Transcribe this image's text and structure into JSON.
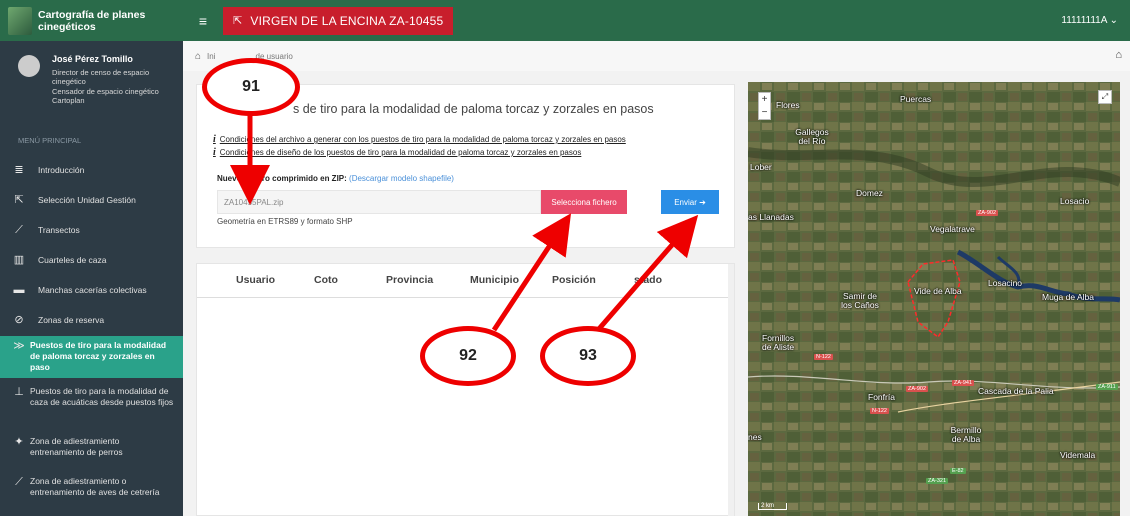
{
  "app": {
    "title": "Cartografía de planes cinegéticos",
    "coto_label": "VIRGEN DE LA ENCINA ZA-10455",
    "user_code": "11111111A ⌄"
  },
  "profile": {
    "name": "José Pérez Tomillo",
    "role1": "Director de censo de espacio cinegético",
    "role2": "Censador de espacio cinegético",
    "role3": "Cartoplan"
  },
  "menu": {
    "title": "MENÚ PRINCIPAL",
    "items": [
      {
        "label": "Introducción",
        "icon": "≣"
      },
      {
        "label": "Selección Unidad Gestión",
        "icon": "⇱"
      },
      {
        "label": "Transectos",
        "icon": "⟋"
      },
      {
        "label": "Cuarteles de caza",
        "icon": "▥"
      },
      {
        "label": "Manchas cacerías colectivas",
        "icon": "▬"
      },
      {
        "label": "Zonas de reserva",
        "icon": "⊘"
      },
      {
        "label": "Puestos de tiro para la modalidad de paloma torcaz y zorzales en paso",
        "icon": "≫"
      },
      {
        "label": "Puestos de tiro para la modalidad de caza de acuáticas desde puestos fijos",
        "icon": "⊥"
      },
      {
        "label": "Zona de adiestramiento entrenamiento de perros",
        "icon": "✦"
      },
      {
        "label": "Zona de adiestramiento o entrenamiento de aves de cetrería",
        "icon": "⟋"
      }
    ]
  },
  "breadcrumb": {
    "home": "Ini",
    "current": "de usuario"
  },
  "upload": {
    "title": "s de tiro para la modalidad de paloma torcaz y zorzales en pasos",
    "cond1": "Condiciones del archivo a generar con los puestos de tiro para la modalidad de paloma torcaz y zorzales en pasos",
    "cond2": "Condiciones de diseño de los puestos de tiro para la modalidad de paloma torcaz y zorzales en pasos",
    "zip_label": "Nuevo fi      ro comprimido en ZIP:",
    "download_link": "(Descargar modelo shapefile)",
    "file_value": "ZA10455PAL.zip",
    "select_button": "Selecciona fichero",
    "send_button": "Enviar ➔",
    "geo_note": "Geometría en ETRS89 y formato SHP"
  },
  "table": {
    "headers": [
      "Usuario",
      "Coto",
      "Provincia",
      "Municipio",
      "Posición",
      "stado"
    ]
  },
  "map": {
    "labels": [
      "Flores",
      "Puercas",
      "Gallegos del Río",
      "Lober",
      "Domez",
      "Losacio",
      "Vegalatrave",
      "Samir de los Caños",
      "Vide de Alba",
      "Losacino",
      "Muga de Alba",
      "Fornillos de Aliste",
      "Fonfría",
      "Cascada de la Palia",
      "Bermillo de Alba",
      "Videmala",
      "nes",
      "as Llanadas"
    ],
    "roads": [
      "ZA-902",
      "N-122",
      "ZA-902",
      "N-122",
      "ZA-941",
      "ZA-911",
      "E-82",
      "ZA-321"
    ],
    "scale": "2 km",
    "zoom_in": "+",
    "zoom_out": "−",
    "expand": "⤢"
  },
  "callouts": {
    "a": "91",
    "b": "92",
    "c": "93"
  }
}
